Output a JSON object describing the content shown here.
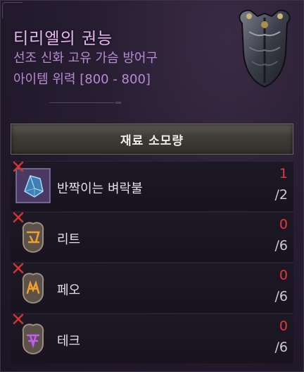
{
  "item": {
    "name": "티리엘의 권능",
    "type": "선조 신화 고유 가슴 방어구",
    "power": "아이템 위력 [800 - 800]"
  },
  "materials_header": "재료 소모량",
  "materials": [
    {
      "name": "반짝이는 벼락불",
      "have": "1",
      "need": "/2",
      "icon": "shimmering-gem-icon"
    },
    {
      "name": "리트",
      "have": "0",
      "need": "/6",
      "icon": "rune-lith-icon"
    },
    {
      "name": "페오",
      "have": "0",
      "need": "/6",
      "icon": "rune-feo-icon"
    },
    {
      "name": "테크",
      "have": "0",
      "need": "/6",
      "icon": "rune-tec-icon"
    }
  ],
  "colors": {
    "title": "#e6b7f2",
    "subtitle": "#b98ad3",
    "insufficient": "#e23b3b"
  }
}
